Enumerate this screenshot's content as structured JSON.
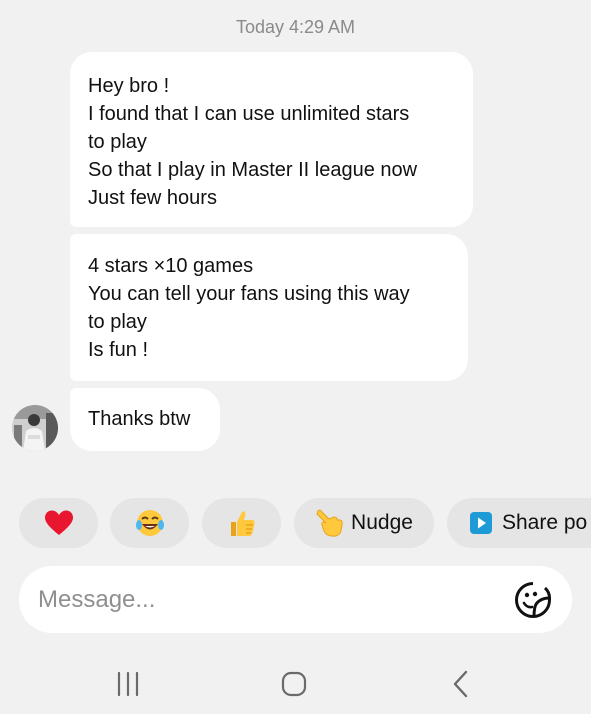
{
  "header": {
    "timestamp": "Today 4:29 AM"
  },
  "messages": [
    {
      "lines": [
        "Hey bro !",
        "I found that I can use unlimited stars",
        "to play",
        "So that I play in Master II league now",
        "Just few hours"
      ]
    },
    {
      "lines": [
        "4 stars ×10 games",
        "You can tell your fans using this way",
        "to play",
        "Is fun !"
      ]
    },
    {
      "lines": [
        "Thanks btw"
      ]
    }
  ],
  "quick_replies": [
    {
      "icon": "red-heart-icon",
      "label": ""
    },
    {
      "icon": "tears-of-joy-emoji-icon",
      "label": ""
    },
    {
      "icon": "thumbs-up-emoji-icon",
      "label": ""
    },
    {
      "icon": "pointing-hand-emoji-icon",
      "label": "Nudge"
    },
    {
      "icon": "share-play-icon",
      "label": "Share po"
    }
  ],
  "composer": {
    "placeholder": "Message...",
    "sticker_icon": "sticker-face-icon"
  },
  "navbar": {
    "icons": [
      "recent-apps-icon",
      "home-icon",
      "back-icon"
    ]
  },
  "colors": {
    "background": "#f1f1f1",
    "bubble": "#ffffff",
    "chip": "#e5e5e5",
    "timestamp": "#8a8a8a",
    "share_blue": "#1e9bd7"
  }
}
